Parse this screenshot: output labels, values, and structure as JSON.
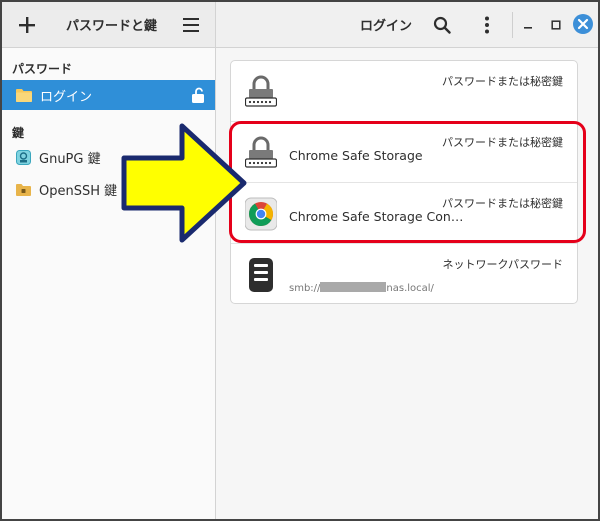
{
  "app": {
    "title": "パスワードと鍵",
    "view_title": "ログイン"
  },
  "header": {
    "add_icon": "plus-icon",
    "menu_icon": "hamburger-menu-icon",
    "search_icon": "search-icon",
    "more_icon": "vertical-dots-icon",
    "window_controls": [
      "minimize",
      "maximize",
      "close"
    ]
  },
  "sidebar": {
    "sections": [
      {
        "heading": "パスワード",
        "items": [
          {
            "label": "ログイン",
            "icon": "folder-icon",
            "selected": true,
            "unlocked": true
          }
        ]
      },
      {
        "heading": "鍵",
        "items": [
          {
            "label": "GnuPG 鍵",
            "icon": "gnupg-key-icon"
          },
          {
            "label": "OpenSSH 鍵",
            "icon": "openssh-folder-icon"
          }
        ]
      }
    ]
  },
  "items": [
    {
      "name": "",
      "type": "パスワードまたは秘密鍵",
      "icon": "password-lock-icon"
    },
    {
      "name": "Chrome Safe Storage",
      "type": "パスワードまたは秘密鍵",
      "icon": "password-lock-icon"
    },
    {
      "name": "Chrome Safe Storage Con…",
      "type": "パスワードまたは秘密鍵",
      "icon": "chrome-icon"
    },
    {
      "name": "",
      "type": "ネットワークパスワード",
      "icon": "server-icon",
      "subtitle_prefix": "smb://",
      "subtitle_suffix": "nas.local/"
    }
  ],
  "colors": {
    "accent": "#2f8fd8",
    "highlight": "#e5001a",
    "arrow_fill": "#ffff00",
    "arrow_stroke": "#1a2a6e",
    "close_button": "#3c8fd8"
  }
}
